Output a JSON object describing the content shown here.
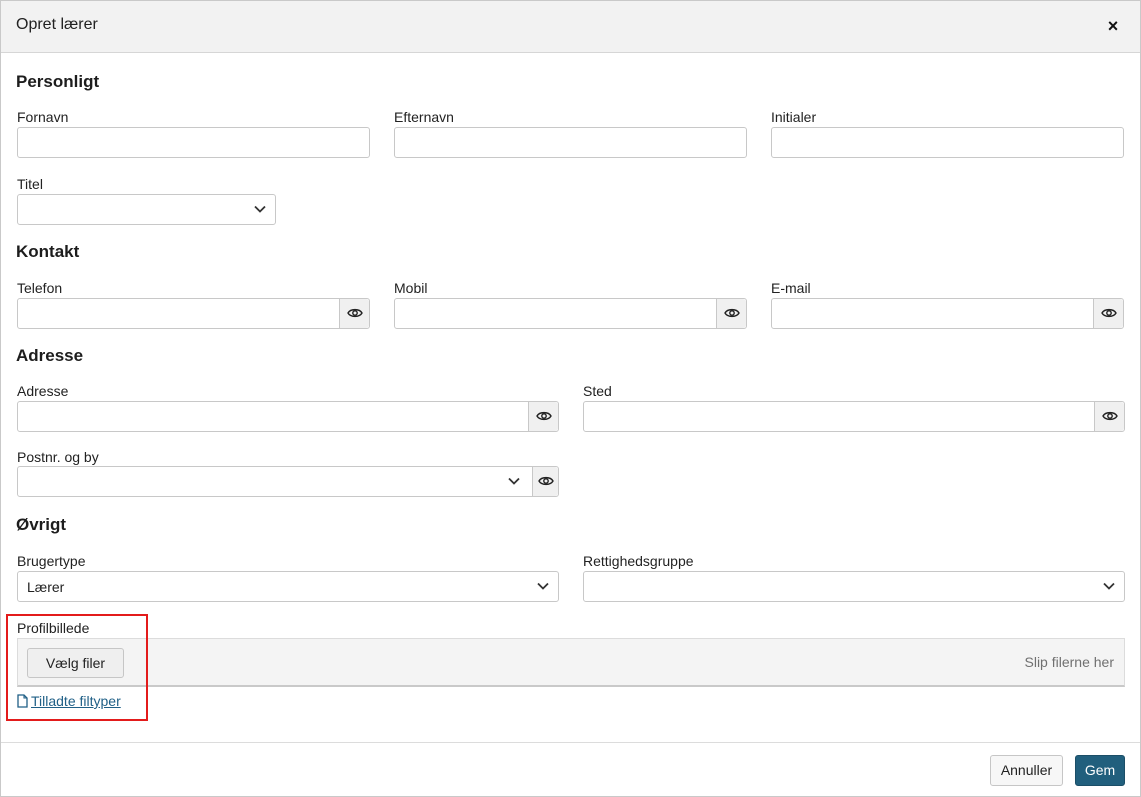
{
  "dialog": {
    "title": "Opret lærer",
    "close_symbol": "×"
  },
  "sections": {
    "personal": "Personligt",
    "contact": "Kontakt",
    "address": "Adresse",
    "other": "Øvrigt"
  },
  "fields": {
    "first_name": {
      "label": "Fornavn",
      "value": ""
    },
    "last_name": {
      "label": "Efternavn",
      "value": ""
    },
    "initials": {
      "label": "Initialer",
      "value": ""
    },
    "title": {
      "label": "Titel",
      "value": ""
    },
    "phone": {
      "label": "Telefon",
      "value": ""
    },
    "mobile": {
      "label": "Mobil",
      "value": ""
    },
    "email": {
      "label": "E-mail",
      "value": ""
    },
    "address": {
      "label": "Adresse",
      "value": ""
    },
    "place": {
      "label": "Sted",
      "value": ""
    },
    "postal_city": {
      "label": "Postnr. og by",
      "value": ""
    },
    "user_type": {
      "label": "Brugertype",
      "value": "Lærer"
    },
    "permission_group": {
      "label": "Rettighedsgruppe",
      "value": ""
    },
    "profile_picture": {
      "label": "Profilbillede"
    }
  },
  "upload": {
    "choose_label": "Vælg filer",
    "drop_hint": "Slip filerne her",
    "allowed_types_label": "Tilladte filtyper"
  },
  "footer": {
    "cancel_label": "Annuller",
    "save_label": "Gem"
  },
  "icons": {
    "eye": "eye-icon",
    "chevron": "chevron-down-icon",
    "file": "file-icon",
    "close": "close-icon"
  },
  "colors": {
    "primary": "#215f7d",
    "link": "#1f5f86",
    "highlight": "#e31b1b",
    "header_bg": "#f2f2f2"
  }
}
